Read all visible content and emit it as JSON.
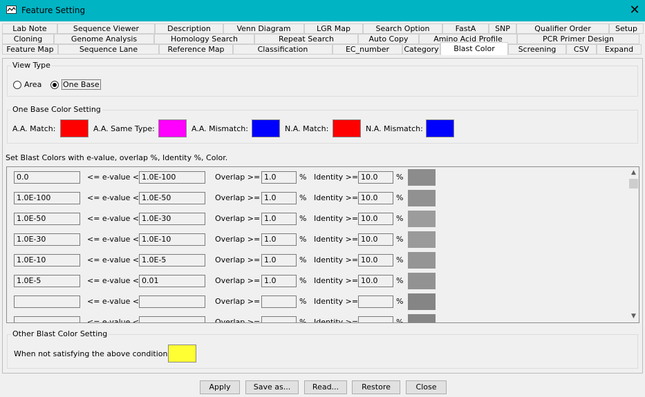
{
  "window": {
    "title": "Feature Setting"
  },
  "tabs": {
    "row1": [
      "Lab Note",
      "Sequence Viewer",
      "Description",
      "Venn Diagram",
      "LGR Map",
      "Search Option",
      "FastA",
      "SNP",
      "Qualifier Order",
      "Setup"
    ],
    "row2": [
      "Cloning",
      "Genome Analysis",
      "Homology Search",
      "Repeat Search",
      "Auto Copy",
      "Amino Acid Profile",
      "PCR Primer Design"
    ],
    "row3": [
      "Feature Map",
      "Sequence Lane",
      "Reference Map",
      "Classification",
      "EC_number",
      "Category",
      "Blast Color",
      "Screening",
      "CSV",
      "Expand"
    ],
    "active": "Blast Color"
  },
  "view_type": {
    "title": "View Type",
    "options": [
      "Area",
      "One Base"
    ],
    "selected": "One Base"
  },
  "one_base": {
    "title": "One Base Color Setting",
    "items": [
      {
        "label": "A.A. Match:",
        "color": "#ff0000"
      },
      {
        "label": "A.A. Same Type:",
        "color": "#ff00ff"
      },
      {
        "label": "A.A. Mismatch:",
        "color": "#0000ff"
      },
      {
        "label": "N.A. Match:",
        "color": "#ff0000"
      },
      {
        "label": "N.A. Mismatch:",
        "color": "#0000ff"
      }
    ]
  },
  "blast": {
    "heading": "Set Blast Colors with e-value, overlap %, Identity %, Color.",
    "evalue_label": "<= e-value <",
    "overlap_label": "Overlap >=",
    "identity_label": "Identity >=",
    "pct": "%",
    "rows": [
      {
        "from": "0.0",
        "to": "1.0E-100",
        "overlap": "1.0",
        "identity": "10.0",
        "color": "#8c8c8c"
      },
      {
        "from": "1.0E-100",
        "to": "1.0E-50",
        "overlap": "1.0",
        "identity": "10.0",
        "color": "#919191"
      },
      {
        "from": "1.0E-50",
        "to": "1.0E-30",
        "overlap": "1.0",
        "identity": "10.0",
        "color": "#9c9c9c"
      },
      {
        "from": "1.0E-30",
        "to": "1.0E-10",
        "overlap": "1.0",
        "identity": "10.0",
        "color": "#9a9a9a"
      },
      {
        "from": "1.0E-10",
        "to": "1.0E-5",
        "overlap": "1.0",
        "identity": "10.0",
        "color": "#959595"
      },
      {
        "from": "1.0E-5",
        "to": "0.01",
        "overlap": "1.0",
        "identity": "10.0",
        "color": "#929292"
      },
      {
        "from": "",
        "to": "",
        "overlap": "",
        "identity": "",
        "color": "#858585"
      },
      {
        "from": "",
        "to": "",
        "overlap": "",
        "identity": "",
        "color": "#858585"
      }
    ]
  },
  "other": {
    "title": "Other Blast Color Setting",
    "label": "When not satisfying the above conditions:",
    "color": "#ffff33"
  },
  "buttons": [
    "Apply",
    "Save as...",
    "Read...",
    "Restore",
    "Close"
  ]
}
